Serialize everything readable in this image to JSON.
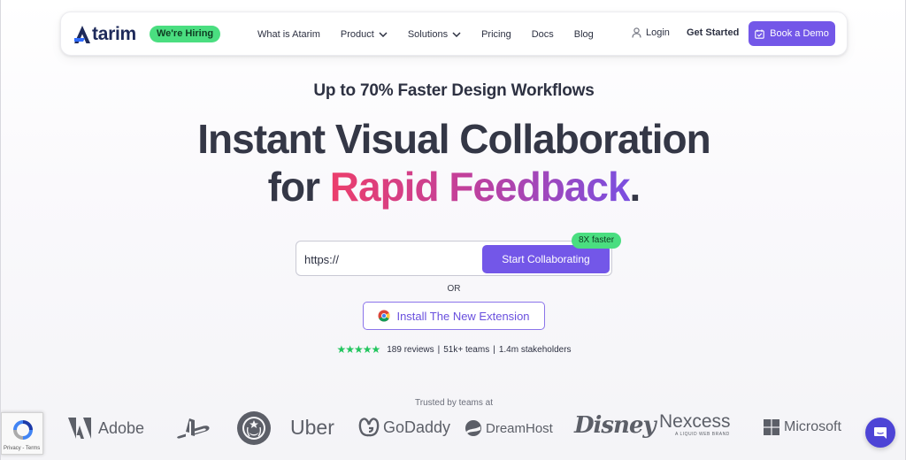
{
  "nav": {
    "logo_text": "tarim",
    "hiring_badge": "We're Hiring",
    "links": [
      {
        "label": "What is Atarim",
        "has_dropdown": false
      },
      {
        "label": "Product",
        "has_dropdown": true
      },
      {
        "label": "Solutions",
        "has_dropdown": true
      },
      {
        "label": "Pricing",
        "has_dropdown": false
      },
      {
        "label": "Docs",
        "has_dropdown": false
      },
      {
        "label": "Blog",
        "has_dropdown": false
      }
    ],
    "login": "Login",
    "get_started": "Get Started",
    "book_demo": "Book a Demo"
  },
  "hero": {
    "kicker": "Up to 70% Faster Design Workflows",
    "headline_line1": "Instant Visual Collaboration",
    "headline_line2_prefix": "for ",
    "headline_line2_highlight": "Rapid Feedback",
    "headline_line2_suffix": ".",
    "url_input_value": "https://",
    "collab_button": "Start Collaborating",
    "faster_badge": "8X faster",
    "or_text": "OR",
    "extension_button": "Install The New Extension",
    "stars": "★★★★★",
    "reviews": "189 reviews",
    "teams": "51k+ teams",
    "stakeholders": "1.4m stakeholders",
    "separator": "|"
  },
  "trusted": {
    "label": "Trusted by teams at",
    "brands": [
      "Adobe",
      "PlayStation",
      "Starbucks",
      "Uber",
      "GoDaddy",
      "DreamHost",
      "Disney",
      "Nexcess",
      "Microsoft"
    ],
    "adobe": "Adobe",
    "uber": "Uber",
    "godaddy": "GoDaddy",
    "dreamhost": "DreamHost",
    "disney": "Disney",
    "nexcess": "Nexcess",
    "nexcess_sub": "A LIQUID WEB BRAND",
    "microsoft": "Microsoft"
  },
  "recaptcha": {
    "text": "Privacy - Terms"
  },
  "icons": {
    "logo": "atarim-logo-icon",
    "user": "user-icon",
    "calendar": "calendar-check-icon",
    "chrome": "chrome-icon",
    "chat": "chat-icon",
    "recaptcha": "recaptcha-icon"
  },
  "colors": {
    "primary": "#7357e8",
    "green_badge": "#4ade80",
    "heading": "#343746",
    "gradient_start": "#ec3e6b",
    "gradient_end": "#7a4fe0",
    "chat_bubble": "#4d44d6"
  }
}
